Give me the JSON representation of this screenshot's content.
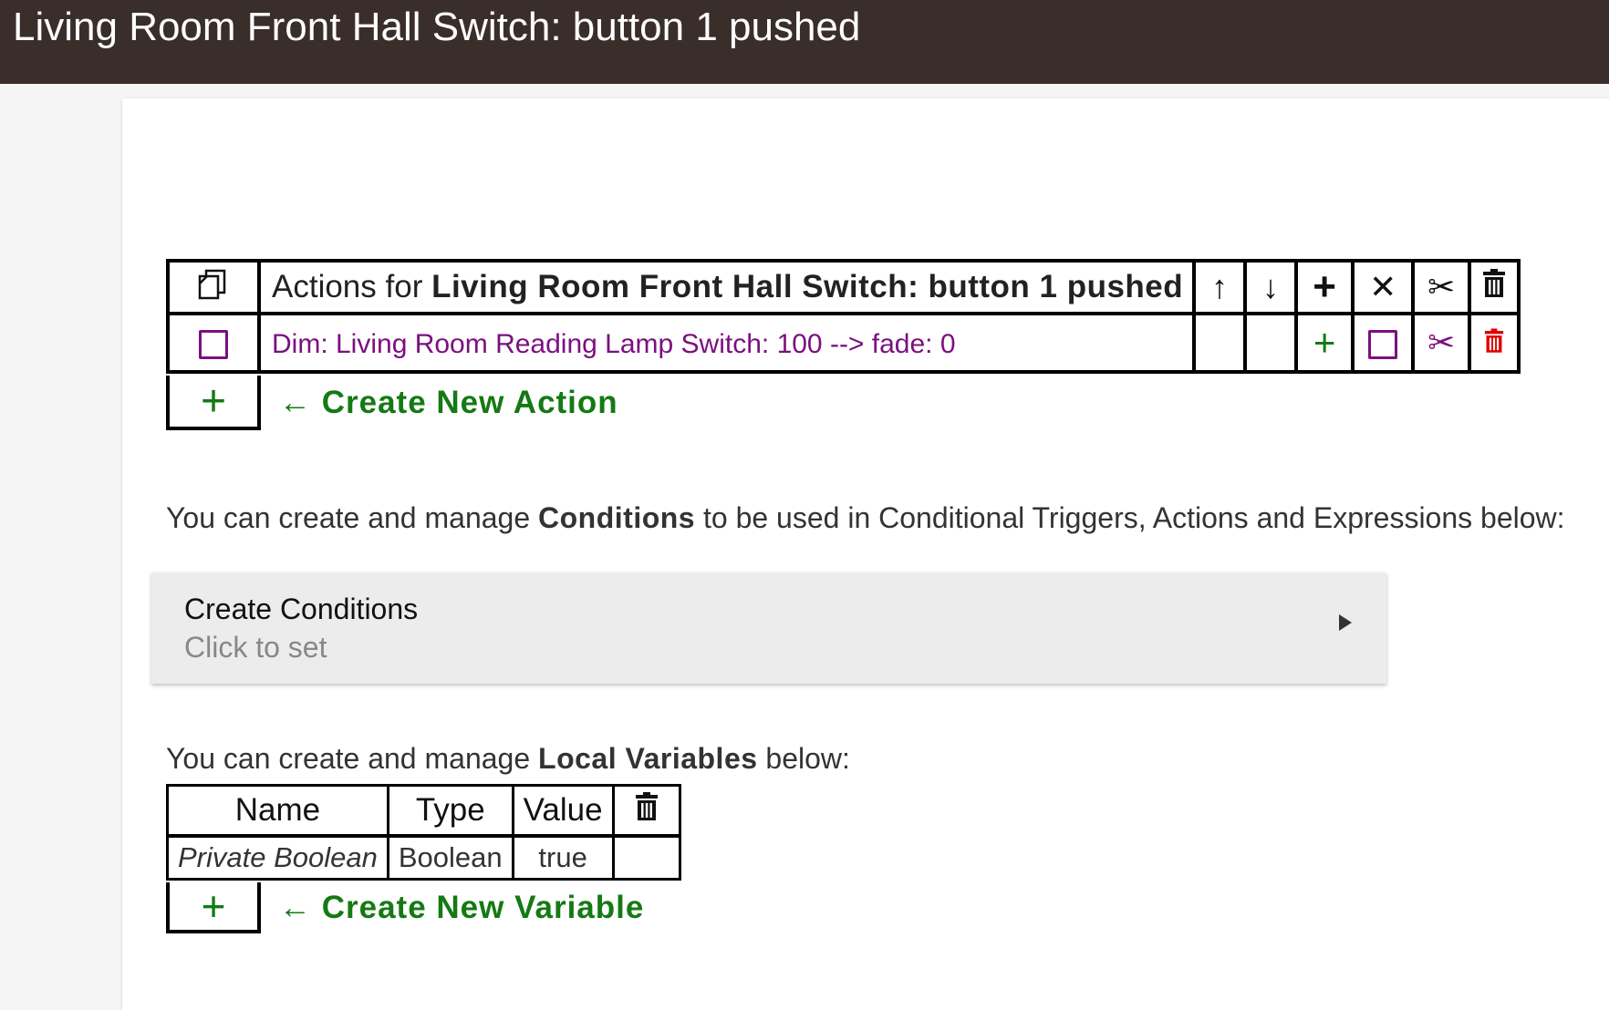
{
  "topbar": {
    "title": "Living Room Front Hall Switch: button 1 pushed"
  },
  "actions": {
    "header_prefix": "Actions for ",
    "header_name": "Living Room Front Hall Switch: button 1 pushed",
    "header_icons": {
      "copy": "copy-icon",
      "up": "↑",
      "down": "↓",
      "add": "+",
      "cancel": "✕",
      "cut": "✂",
      "delete": "trash-icon"
    },
    "rows": [
      {
        "text": "Dim: Living Room Reading Lamp Switch: 100 --> fade: 0",
        "add": "+",
        "cut": "✂"
      }
    ],
    "create_plus": "+",
    "create_label": "← Create New Action"
  },
  "conditions": {
    "intro_before": "You can create and manage ",
    "intro_bold": "Conditions",
    "intro_after": " to be used in Conditional Triggers, Actions and Expressions below:",
    "box_title": "Create Conditions",
    "box_subtitle": "Click to set"
  },
  "variables": {
    "intro_before": "You can create and manage ",
    "intro_bold": "Local Variables",
    "intro_after": " below:",
    "columns": [
      "Name",
      "Type",
      "Value"
    ],
    "rows": [
      {
        "name": "Private Boolean",
        "type": "Boolean",
        "value": "true"
      }
    ],
    "create_plus": "+",
    "create_label": "← Create New Variable"
  },
  "colors": {
    "topbar": "#3a2e2b",
    "green": "#147a14",
    "purple": "#7b1080",
    "red": "#e00000"
  }
}
